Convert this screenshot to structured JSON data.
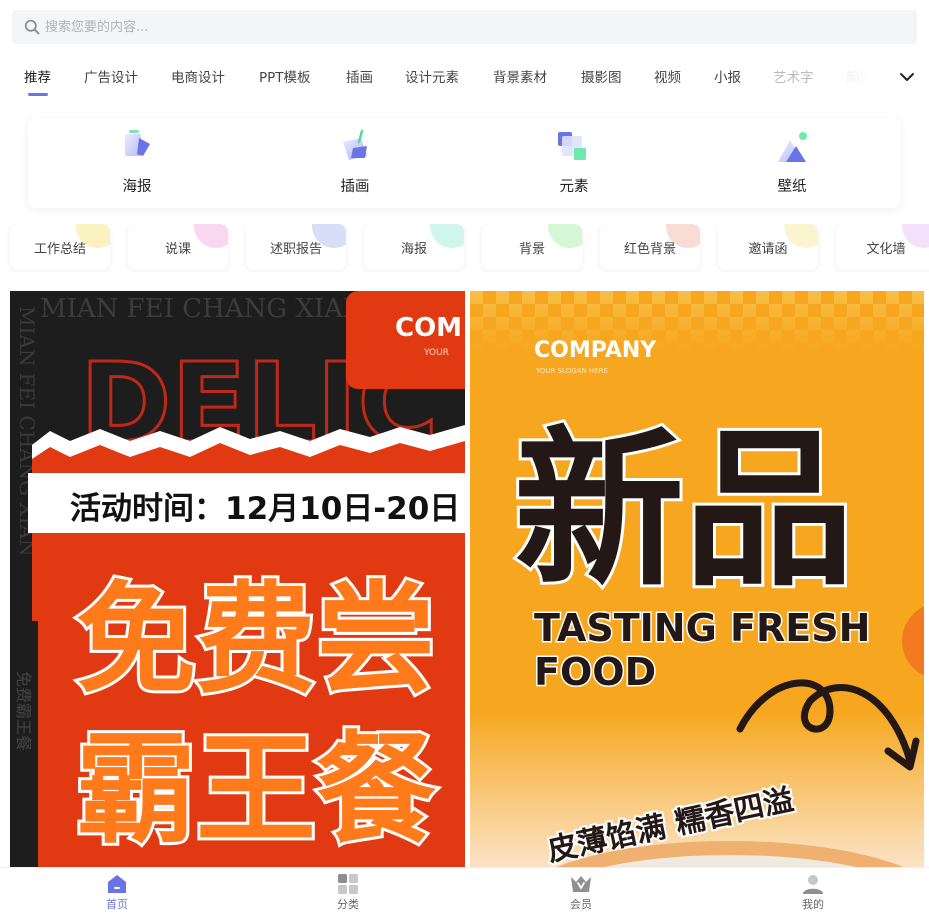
{
  "search": {
    "placeholder": "搜索您要的内容..."
  },
  "tabs": [
    {
      "label": "推荐"
    },
    {
      "label": "广告设计"
    },
    {
      "label": "电商设计"
    },
    {
      "label": "PPT模板"
    },
    {
      "label": "插画"
    },
    {
      "label": "设计元素"
    },
    {
      "label": "背景素材"
    },
    {
      "label": "摄影图"
    },
    {
      "label": "视频"
    },
    {
      "label": "小报"
    },
    {
      "label": "艺术字"
    },
    {
      "label": "简历"
    }
  ],
  "categories": [
    {
      "label": "海报",
      "icon": "poster-icon"
    },
    {
      "label": "插画",
      "icon": "illustration-icon"
    },
    {
      "label": "元素",
      "icon": "element-icon"
    },
    {
      "label": "壁纸",
      "icon": "wallpaper-icon"
    }
  ],
  "pills": [
    {
      "label": "工作总结",
      "color": "#f5e88a"
    },
    {
      "label": "说课",
      "color": "#f4b7e6"
    },
    {
      "label": "述职报告",
      "color": "#b9c3f3"
    },
    {
      "label": "海报",
      "color": "#a9ecd9"
    },
    {
      "label": "背景",
      "color": "#b5f0b2"
    },
    {
      "label": "红色背景",
      "color": "#f6c0b4"
    },
    {
      "label": "邀请函",
      "color": "#f6ecaa"
    },
    {
      "label": "文化墙",
      "color": "#e9c6f5"
    }
  ],
  "posters": {
    "left": {
      "bg_text": "MIAN FEI CHANG XIAN",
      "side_text": "MIAN FEI CHANG XIAN",
      "brand": "COM",
      "brand_sub": "YOUR",
      "big_word": "DELIC",
      "event_time": "活动时间：12月10日-20日",
      "headline_1": "免费尝",
      "headline_2": "霸王餐",
      "vertical_cn": "免费霸王餐",
      "colors": {
        "dark": "#1d1d1d",
        "red": "#e13a12",
        "orange": "#ff7a1a"
      }
    },
    "right": {
      "brand": "COMPANY",
      "brand_sub": "YOUR SLOGAN HERE",
      "headline": "新品",
      "sub_1": "TASTING FRESH",
      "sub_2": "FOOD",
      "tagline": "皮薄馅满 糯香四溢",
      "colors": {
        "bg": "#f6a71f",
        "text": "#231815"
      }
    }
  },
  "bottom_nav": [
    {
      "label": "首页",
      "icon": "home-icon",
      "active": true
    },
    {
      "label": "分类",
      "icon": "grid-icon",
      "active": false
    },
    {
      "label": "会员",
      "icon": "vip-crown-icon",
      "active": false
    },
    {
      "label": "我的",
      "icon": "user-icon",
      "active": false
    }
  ],
  "accent_color": "#6b74e6"
}
